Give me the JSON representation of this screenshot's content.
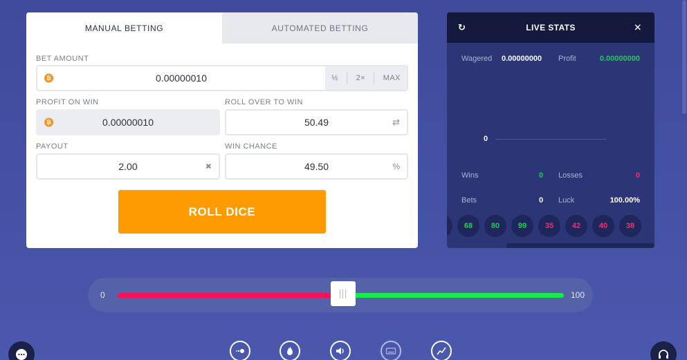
{
  "betting": {
    "tabs": [
      "MANUAL BETTING",
      "AUTOMATED BETTING"
    ],
    "bet_amount": {
      "label": "BET AMOUNT",
      "value": "0.00000010",
      "half_label": "½",
      "double_label": "2×",
      "max_label": "MAX"
    },
    "profit_on_win": {
      "label": "PROFIT ON WIN",
      "value": "0.00000010"
    },
    "roll_over": {
      "label": "ROLL OVER TO WIN",
      "value": "50.49",
      "suffix": "⇄"
    },
    "payout": {
      "label": "PAYOUT",
      "value": "2.00",
      "suffix": "✖"
    },
    "win_chance": {
      "label": "WIN CHANCE",
      "value": "49.50",
      "suffix": "%"
    },
    "roll_button": "ROLL DICE",
    "currency_symbol": "₿"
  },
  "live_stats": {
    "title": "LIVE STATS",
    "refresh_icon": "↻",
    "close_icon": "✕",
    "wagered_label": "Wagered",
    "wagered_value": "0.00000000",
    "profit_label": "Profit",
    "profit_value": "0.00000000",
    "chart_zero": "0",
    "wins_label": "Wins",
    "wins_value": "0",
    "losses_label": "Losses",
    "losses_value": "0",
    "bets_label": "Bets",
    "bets_value": "0",
    "luck_label": "Luck",
    "luck_value": "100.00%",
    "history": [
      {
        "value": "",
        "color": "green"
      },
      {
        "value": "68",
        "color": "green"
      },
      {
        "value": "80",
        "color": "green"
      },
      {
        "value": "99",
        "color": "green"
      },
      {
        "value": "35",
        "color": "pink"
      },
      {
        "value": "42",
        "color": "pink"
      },
      {
        "value": "40",
        "color": "pink"
      },
      {
        "value": "38",
        "color": "pink"
      }
    ]
  },
  "slider": {
    "min_label": "0",
    "max_label": "100",
    "value": 50.49,
    "min": 0,
    "max": 100
  },
  "toolbar": {
    "icons": [
      "rewind-icon",
      "fire-icon",
      "sound-icon",
      "keyboard-icon",
      "chart-icon"
    ]
  },
  "colors": {
    "accent_orange": "#fd9b00",
    "win_green": "#16d34b",
    "loss_pink": "#ff2a6b",
    "track_red": "#ff0f57",
    "track_green": "#19e84b"
  }
}
